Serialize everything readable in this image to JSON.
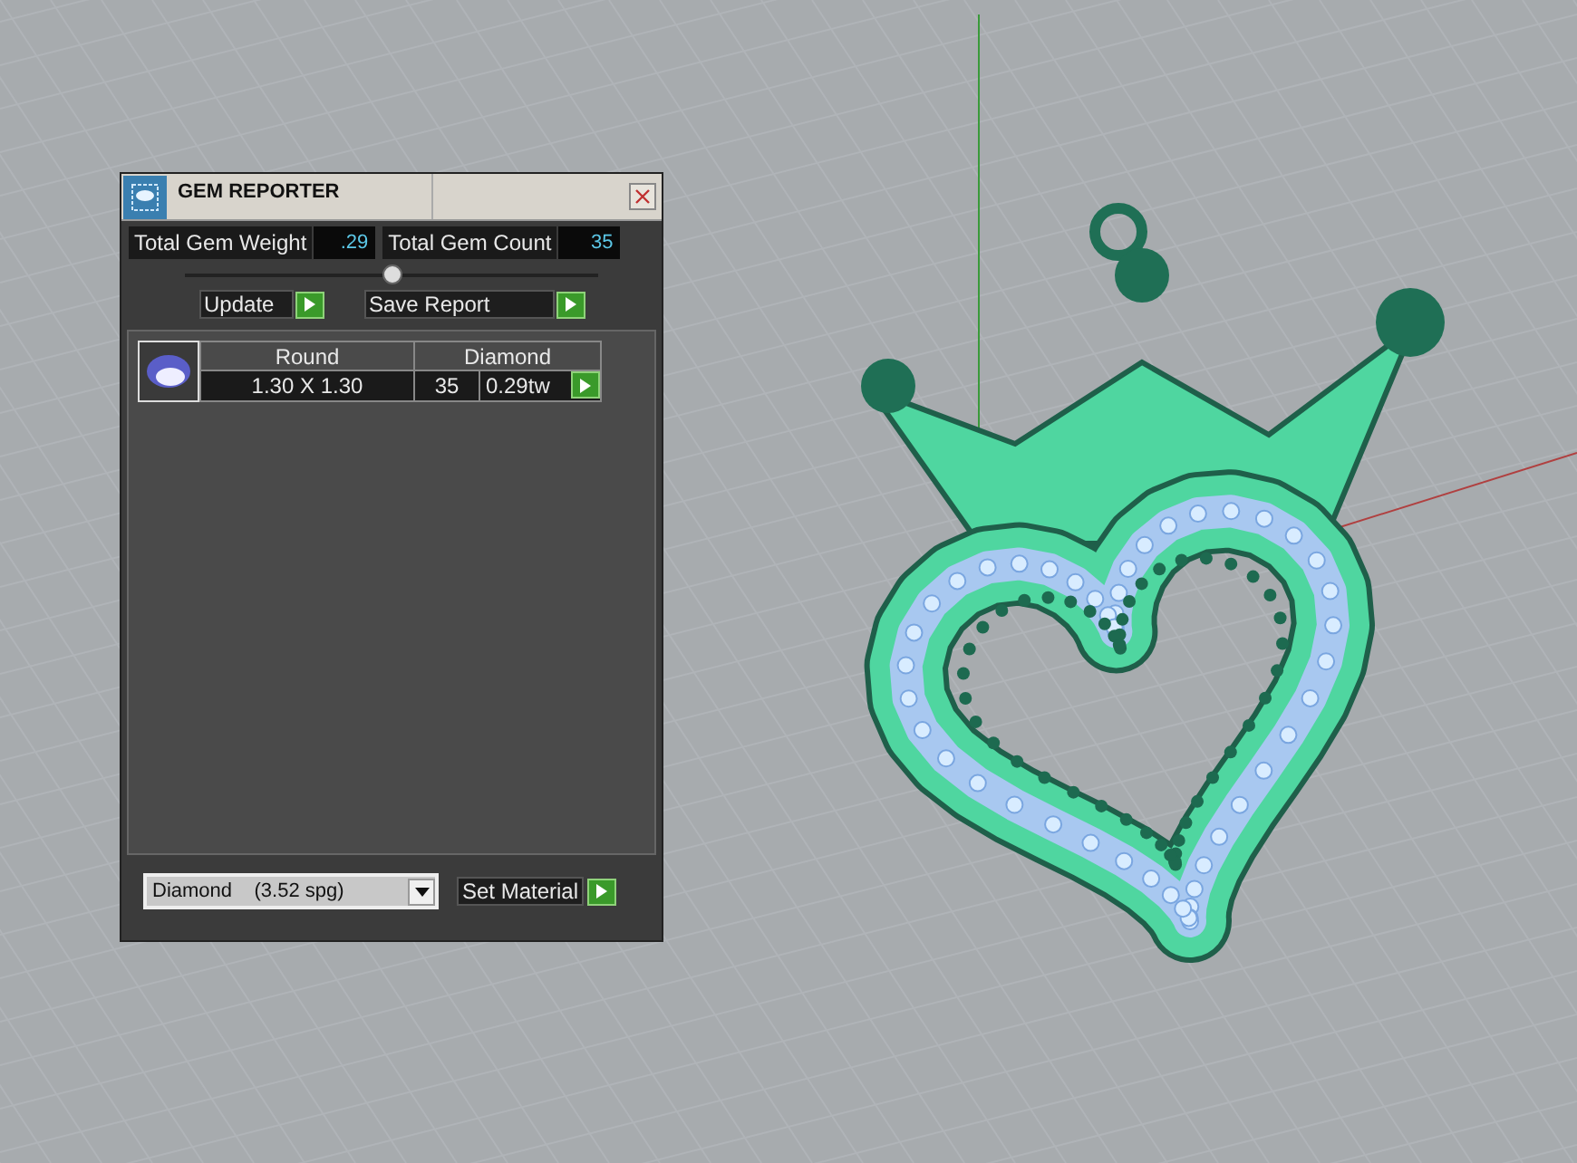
{
  "window": {
    "title": "GEM REPORTER"
  },
  "totals": [
    {
      "label": "Total Gem Weight",
      "value": ".29"
    },
    {
      "label": "Total Gem Count",
      "value": "35"
    }
  ],
  "buttons": [
    {
      "label": "Update"
    },
    {
      "label": "Save Report"
    }
  ],
  "gems": [
    {
      "shape": "Round",
      "material": "Diamond",
      "size": "1.30 X 1.30",
      "count": "35",
      "weight": "0.29tw"
    }
  ],
  "material_select": {
    "value": "Diamond    (3.52 spg)"
  },
  "set_button": {
    "label": "Set Material"
  }
}
